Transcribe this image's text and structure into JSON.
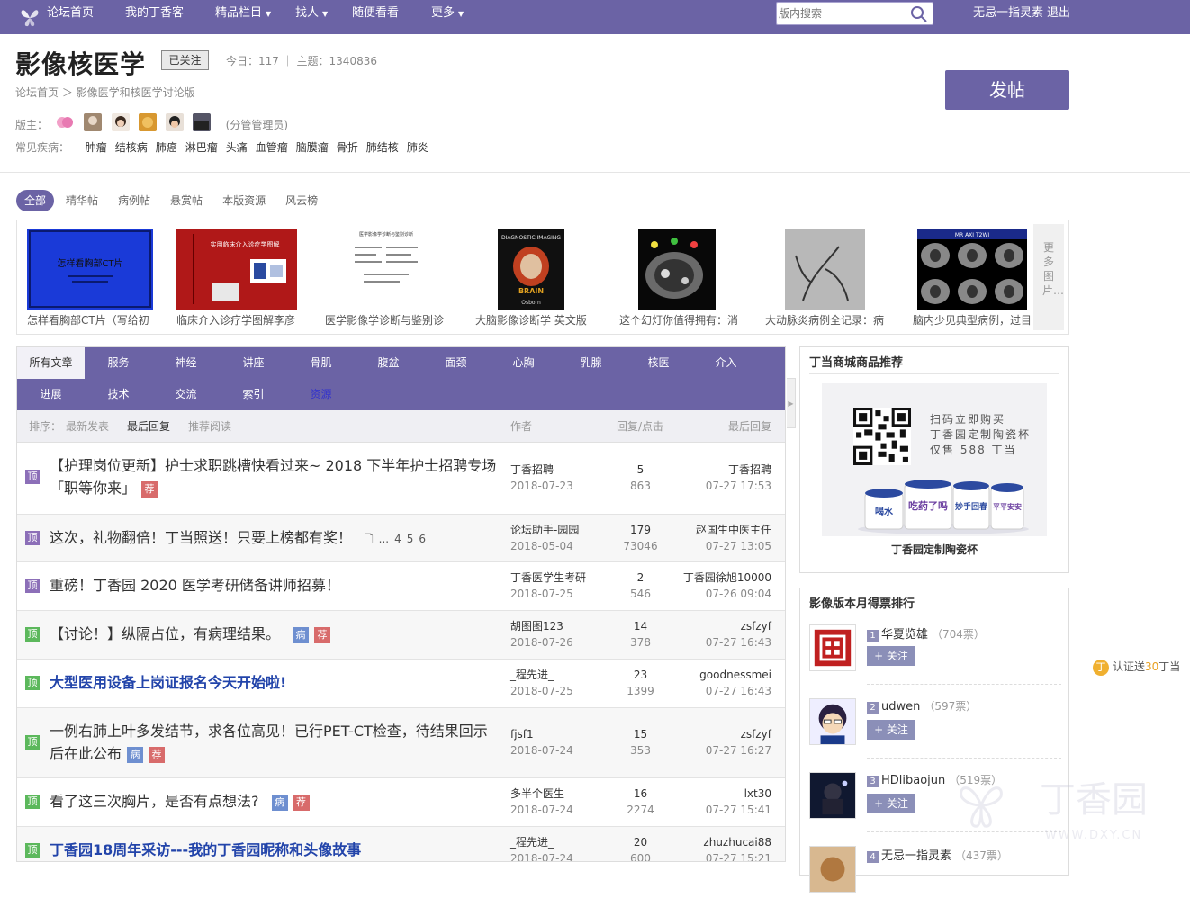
{
  "topnav": {
    "items": [
      "论坛首页",
      "我的丁香客",
      "精品栏目",
      "找人",
      "随便看看",
      "更多"
    ],
    "search_placeholder": "版内搜索",
    "user": "无忌一指灵素",
    "logout": "退出"
  },
  "header": {
    "title": "影像核医学",
    "follow_badge": "已关注",
    "stats": "今日：117 ｜ 主题：1340836",
    "breadcrumb": "论坛首页  ＞  影像医学和核医学讨论版",
    "moderators_label": "版主：",
    "moderators_suffix": "(分管管理员)",
    "diseases_label": "常见疾病：",
    "diseases": [
      "肿瘤",
      "结核病",
      "肺癌",
      "淋巴瘤",
      "头痛",
      "血管瘤",
      "脑膜瘤",
      "骨折",
      "肺结核",
      "肺炎"
    ],
    "post_button": "发帖"
  },
  "filters": [
    "全部",
    "精华帖",
    "病例帖",
    "悬赏帖",
    "本版资源",
    "风云榜"
  ],
  "gallery": {
    "captions": [
      "怎样看胸部CT片（写给初",
      "临床介入诊疗学图解李彦",
      "医学影像学诊断与鉴别诊",
      "大脑影像诊断学 英文版",
      "这个幻灯你值得拥有：消",
      "大动脉炎病例全记录：病",
      "脑内少见典型病例，过目"
    ],
    "more": "更多图片…",
    "thumb_texts": [
      "怎样看胸部CT片",
      "实用临床介入诊疗学图解",
      "医学影像学诊断与鉴别诊断",
      "DIAGNOSTIC IMAGING",
      "BRAIN",
      "Osborn",
      "MR AXI T2WI"
    ]
  },
  "threads": {
    "tabs_row1": [
      "所有文章",
      "服务",
      "神经",
      "讲座",
      "骨肌",
      "腹盆",
      "面颈",
      "心胸",
      "乳腺",
      "核医",
      "介入"
    ],
    "tabs_row2": [
      "进展",
      "技术",
      "交流",
      "索引",
      "资源"
    ],
    "sort_label": "排序：",
    "sort_newest": "最新发表",
    "sort_reply": "最后回复",
    "sort_recommend": "推荐阅读",
    "col_author": "作者",
    "col_counts": "回复/点击",
    "col_last": "最后回复",
    "rows": [
      {
        "pin": "顶",
        "title": "【护理岗位更新】护士求职跳槽快看过来~ 2018 下半年护士招聘专场「职等你来」",
        "tags": [
          "荐"
        ],
        "author": "丁香招聘",
        "date": "2018-07-23",
        "replies": "5",
        "views": "863",
        "last_user": "丁香招聘",
        "last_time": "07-27 17:53"
      },
      {
        "pin": "顶",
        "title": "这次，礼物翻倍！丁当照送！只要上榜都有奖！",
        "pages": [
          "...",
          "4",
          "5",
          "6"
        ],
        "author": "论坛助手-园园",
        "date": "2018-05-04",
        "replies": "179",
        "views": "73046",
        "last_user": "赵国生中医主任",
        "last_time": "07-27 13:05"
      },
      {
        "pin": "顶",
        "title": "重磅！丁香园 2020 医学考研储备讲师招募！",
        "author": "丁香医学生考研",
        "date": "2018-07-25",
        "replies": "2",
        "views": "546",
        "last_user": "丁香园徐旭10000",
        "last_time": "07-26 09:04"
      },
      {
        "pin": "顶",
        "title": "【讨论！】纵隔占位，有病理结果。",
        "tags": [
          "病",
          "荐"
        ],
        "author": "胡图图123",
        "date": "2018-07-26",
        "replies": "14",
        "views": "378",
        "last_user": "zsfzyf",
        "last_time": "07-27 16:43"
      },
      {
        "pin": "顶",
        "title": "大型医用设备上岗证报名今天开始啦!",
        "author": "_程先进_",
        "date": "2018-07-25",
        "replies": "23",
        "views": "1399",
        "last_user": "goodnessmei",
        "last_time": "07-27 16:43"
      },
      {
        "pin": "顶",
        "title": "一例右肺上叶多发结节，求各位高见！已行PET-CT检查，待结果回示后在此公布",
        "tags": [
          "病",
          "荐"
        ],
        "author": "fjsf1",
        "date": "2018-07-24",
        "replies": "15",
        "views": "353",
        "last_user": "zsfzyf",
        "last_time": "07-27 16:27"
      },
      {
        "pin": "顶",
        "title": "看了这三次胸片，是否有点想法?",
        "tags": [
          "病",
          "荐"
        ],
        "author": "多半个医生",
        "date": "2018-07-24",
        "replies": "16",
        "views": "2274",
        "last_user": "lxt30",
        "last_time": "07-27 15:41"
      },
      {
        "pin": "顶",
        "title": "丁香园18周年采访---我的丁香园昵称和头像故事",
        "author": "_程先进_",
        "date": "2018-07-24",
        "replies": "20",
        "views": "600",
        "last_user": "zhuzhucai88",
        "last_time": "07-27 15:21"
      }
    ]
  },
  "shop": {
    "title": "丁当商城商品推荐",
    "ad_text": [
      "扫码立即购买",
      "丁香园定制陶瓷杯",
      "仅售 588 丁当"
    ],
    "mug_texts": [
      "喝水",
      "吃药了吗",
      "妙手回春",
      "平平安安"
    ],
    "caption": "丁香园定制陶瓷杯"
  },
  "ranking": {
    "title": "影像版本月得票排行",
    "follow_label": "+ 关注",
    "items": [
      {
        "rank": "1",
        "name": "华夏览雄",
        "votes": "（704票）"
      },
      {
        "rank": "2",
        "name": "udwen",
        "votes": "（597票）"
      },
      {
        "rank": "3",
        "name": "HDlibaojun",
        "votes": "（519票）"
      },
      {
        "rank": "4",
        "name": "无忌一指灵素",
        "votes": "（437票）"
      }
    ]
  },
  "promo": {
    "prefix": "认证送",
    "amount": "30",
    "suffix": "丁当",
    "coin": "丁"
  },
  "watermark": {
    "text": "丁香园",
    "url": "WWW.DXY.CN"
  },
  "colors": {
    "brand": "#6b63a5",
    "pin_purple": "#8c6fb8",
    "pin_green": "#5cb85c",
    "tag_blue": "#6e8fd0",
    "tag_red": "#d86b6b"
  }
}
